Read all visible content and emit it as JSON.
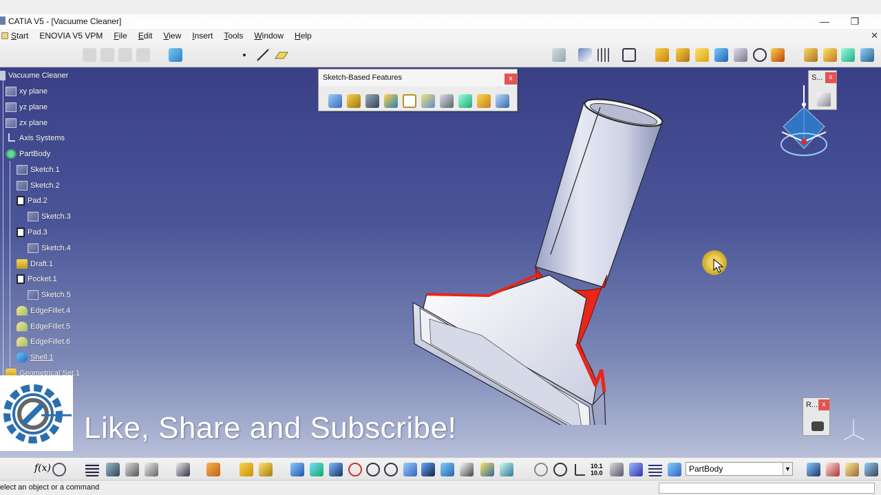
{
  "window": {
    "title": "CATIA V5 - [Vacuume Cleaner]",
    "minimize_glyph": "—",
    "restore_glyph": "❐"
  },
  "menu": {
    "items": [
      "Start",
      "ENOVIA V5 VPM",
      "File",
      "Edit",
      "View",
      "Insert",
      "Tools",
      "Window",
      "Help"
    ],
    "close_glyph": "✕"
  },
  "tree": {
    "root": "Vacuume Cleaner",
    "items": [
      {
        "label": "xy plane",
        "icon": "plane-icon"
      },
      {
        "label": "yz plane",
        "icon": "plane-icon"
      },
      {
        "label": "zx plane",
        "icon": "plane-icon"
      },
      {
        "label": "Axis Systems",
        "icon": "axis-systems-icon"
      },
      {
        "label": "PartBody",
        "icon": "partbody-icon"
      },
      {
        "label": "Sketch.1",
        "icon": "sketch-icon"
      },
      {
        "label": "Sketch.2",
        "icon": "sketch-icon"
      },
      {
        "label": "Pad.2",
        "icon": "pad-icon"
      },
      {
        "label": "Sketch.3",
        "icon": "sketch-icon"
      },
      {
        "label": "Pad.3",
        "icon": "pad-icon"
      },
      {
        "label": "Sketch.4",
        "icon": "sketch-icon"
      },
      {
        "label": "Draft.1",
        "icon": "draft-icon"
      },
      {
        "label": "Pocket.1",
        "icon": "pocket-icon"
      },
      {
        "label": "Sketch.5",
        "icon": "sketch-icon"
      },
      {
        "label": "EdgeFillet.4",
        "icon": "edge-fillet-icon"
      },
      {
        "label": "EdgeFillet.5",
        "icon": "edge-fillet-icon"
      },
      {
        "label": "EdgeFillet.6",
        "icon": "edge-fillet-icon"
      },
      {
        "label": "Shell.1",
        "icon": "shell-icon"
      },
      {
        "label": "Geometrical Set.1",
        "icon": "geometrical-set-icon"
      }
    ]
  },
  "sketch_toolbar": {
    "title": "Sketch-Based Features",
    "close_glyph": "x"
  },
  "mini_toolbar_top": {
    "title": "S...",
    "close_glyph": "x"
  },
  "mini_toolbar_bottom": {
    "title": "R...",
    "close_glyph": "x"
  },
  "overlay": {
    "subscribe_text": "Like, Share and Subscribe!"
  },
  "bottom_toolbar": {
    "body_select": "PartBody",
    "select_arrow": "▼"
  },
  "status": {
    "message": "elect an object or a command"
  },
  "colors": {
    "viewport_top": "#3a3f86",
    "viewport_bottom": "#b7bfd9",
    "highlight_red": "#e8261a",
    "close_red": "#e25454"
  }
}
